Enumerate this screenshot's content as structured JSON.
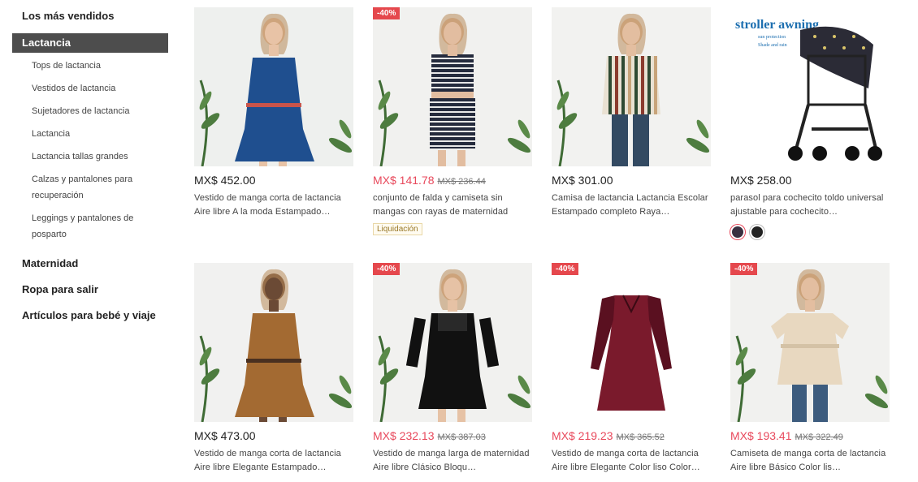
{
  "sidebar": {
    "categories_top": [
      {
        "label": "Los más vendidos",
        "active": false
      },
      {
        "label": "Lactancia",
        "active": true
      }
    ],
    "subcategories": [
      "Tops de lactancia",
      "Vestidos de lactancia",
      "Sujetadores de lactancia",
      "Lactancia",
      "Lactancia tallas grandes",
      "Calzas y pantalones para recuperación",
      "Leggings y pantalones de posparto"
    ],
    "categories_bottom": [
      "Maternidad",
      "Ropa para salir",
      "Artículos para bebé y viaje"
    ]
  },
  "products": [
    {
      "price": "MX$ 452.00",
      "old_price": "",
      "badge": "",
      "sale": false,
      "title": "Vestido de manga corta de lactancia Aire libre A la moda Estampado…",
      "tag": "",
      "img_text": "",
      "img_sub": "",
      "swatches": false,
      "colors": {
        "bg": "#eef0ee",
        "garment": "#1f4f8f",
        "accent": "#e8c3a6"
      }
    },
    {
      "price": "MX$ 141.78",
      "old_price": "MX$ 236.44",
      "badge": "-40%",
      "sale": true,
      "title": "conjunto de falda y camiseta sin mangas con rayas de maternidad",
      "tag": "Liquidación",
      "img_text": "",
      "img_sub": "",
      "swatches": false,
      "colors": {
        "bg": "#f1f1ef",
        "garment": "#252b3d",
        "accent": "#e2bda0"
      }
    },
    {
      "price": "MX$ 301.00",
      "old_price": "",
      "badge": "",
      "sale": false,
      "title": "Camisa de lactancia Lactancia Escolar Estampado completo Raya…",
      "tag": "",
      "img_text": "",
      "img_sub": "",
      "swatches": false,
      "colors": {
        "bg": "#f2f2f0",
        "garment": "#5c6b4d",
        "accent": "#e3bea0"
      }
    },
    {
      "price": "MX$ 258.00",
      "old_price": "",
      "badge": "",
      "sale": false,
      "title": "parasol para cochecito toldo universal ajustable para cochecito…",
      "tag": "",
      "img_text": "stroller awning",
      "img_sub": "sun protection Shade and rain",
      "swatches": true,
      "colors": {
        "bg": "#ffffff",
        "garment": "#2b2b36",
        "accent": "#1d6fb0"
      }
    },
    {
      "price": "MX$ 473.00",
      "old_price": "",
      "badge": "",
      "sale": false,
      "title": "Vestido de manga corta de lactancia Aire libre Elegante Estampado…",
      "tag": "",
      "img_text": "",
      "img_sub": "",
      "swatches": false,
      "colors": {
        "bg": "#f1f1f0",
        "garment": "#a36a32",
        "accent": "#6b4a35"
      }
    },
    {
      "price": "MX$ 232.13",
      "old_price": "MX$ 387.03",
      "badge": "-40%",
      "sale": true,
      "title": "Vestido de manga larga de maternidad Aire libre Clásico Bloqu…",
      "tag": "",
      "img_text": "",
      "img_sub": "",
      "swatches": false,
      "colors": {
        "bg": "#f1f1ef",
        "garment": "#111111",
        "accent": "#e6c2a5"
      }
    },
    {
      "price": "MX$ 219.23",
      "old_price": "MX$ 365.52",
      "badge": "-40%",
      "sale": true,
      "title": "Vestido de manga corta de lactancia Aire libre Elegante Color liso Color…",
      "tag": "",
      "img_text": "",
      "img_sub": "",
      "swatches": false,
      "colors": {
        "bg": "#ffffff",
        "garment": "#7a1a2c",
        "accent": "#5a1020"
      }
    },
    {
      "price": "MX$ 193.41",
      "old_price": "MX$ 322.49",
      "badge": "-40%",
      "sale": true,
      "title": "Camiseta de manga corta de lactancia Aire libre Básico Color lis…",
      "tag": "",
      "img_text": "",
      "img_sub": "",
      "swatches": false,
      "colors": {
        "bg": "#f1f1ef",
        "garment": "#e8d8c0",
        "accent": "#e3bea0"
      }
    }
  ]
}
